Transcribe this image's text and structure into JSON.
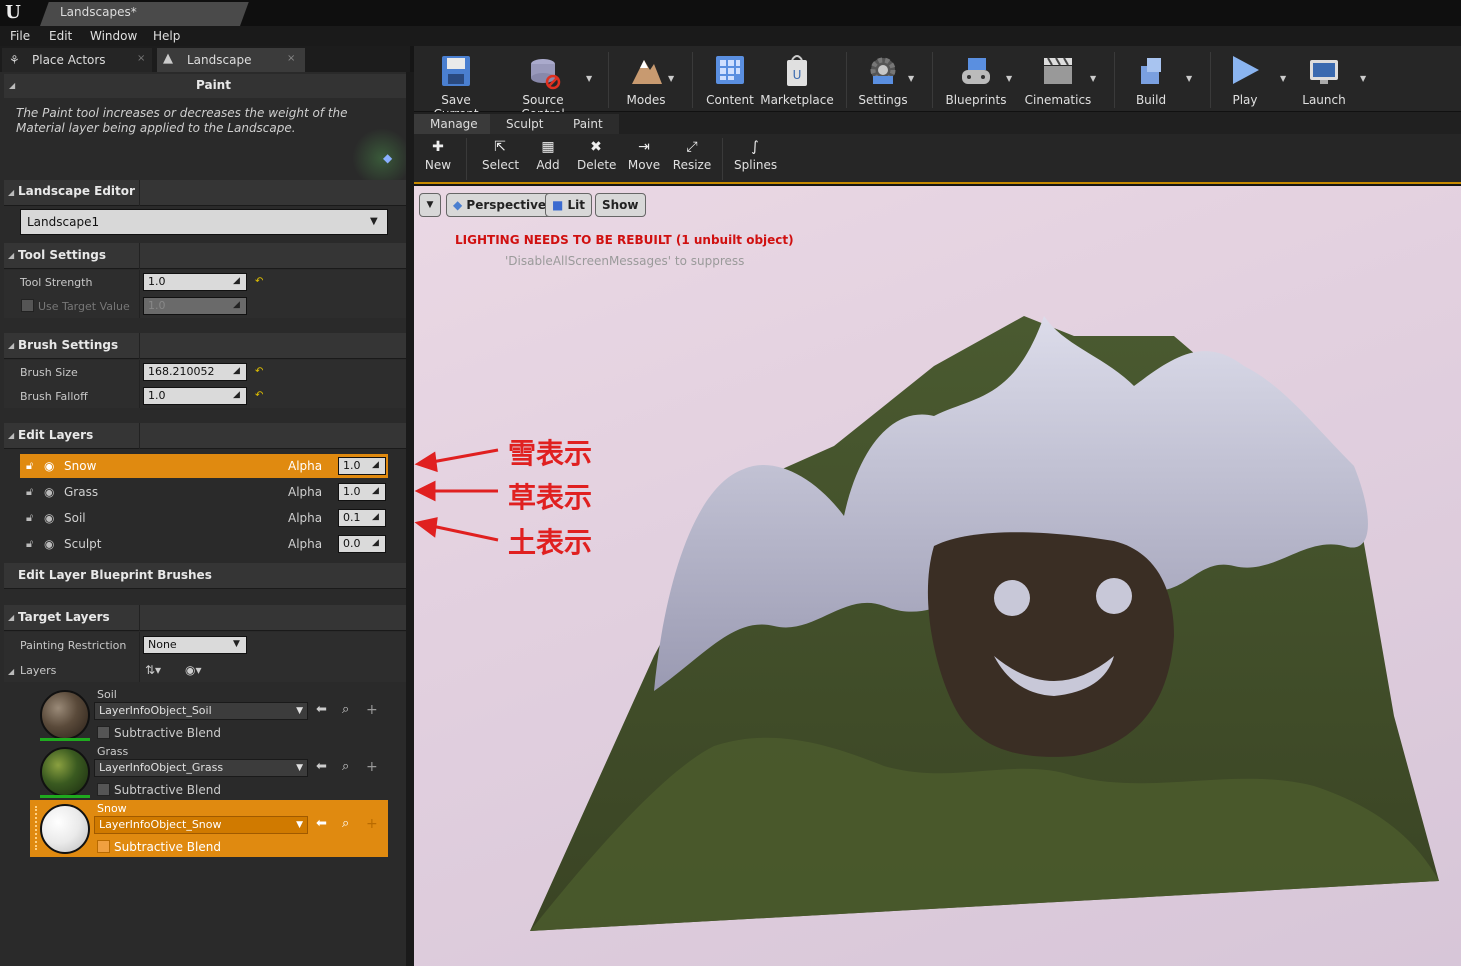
{
  "window": {
    "doc_tab": "Landscapes*"
  },
  "menu": [
    "File",
    "Edit",
    "Window",
    "Help"
  ],
  "left_tabs": {
    "place_actors": "Place Actors",
    "landscape": "Landscape"
  },
  "paint": {
    "title": "Paint",
    "description": "The Paint tool increases or decreases the weight of the Material layer being applied to the Landscape."
  },
  "landscape_editor": {
    "title": "Landscape Editor",
    "selected": "Landscape1"
  },
  "tool_settings": {
    "title": "Tool Settings",
    "tool_strength_label": "Tool Strength",
    "tool_strength": "1.0",
    "use_target_label": "Use Target Value",
    "use_target": "1.0"
  },
  "brush_settings": {
    "title": "Brush Settings",
    "size_label": "Brush Size",
    "size": "168.210052",
    "falloff_label": "Brush Falloff",
    "falloff": "1.0"
  },
  "edit_layers": {
    "title": "Edit Layers",
    "rows": [
      {
        "name": "Snow",
        "alpha_label": "Alpha",
        "alpha": "1.0"
      },
      {
        "name": "Grass",
        "alpha_label": "Alpha",
        "alpha": "1.0"
      },
      {
        "name": "Soil",
        "alpha_label": "Alpha",
        "alpha": "0.1"
      },
      {
        "name": "Sculpt",
        "alpha_label": "Alpha",
        "alpha": "0.0"
      }
    ]
  },
  "blueprint_brushes": {
    "title": "Edit Layer Blueprint Brushes"
  },
  "target_layers": {
    "title": "Target Layers",
    "restriction_label": "Painting Restriction",
    "restriction": "None",
    "layers_label": "Layers",
    "items": [
      {
        "name": "Soil",
        "object": "LayerInfoObject_Soil",
        "blend": "Subtractive Blend"
      },
      {
        "name": "Grass",
        "object": "LayerInfoObject_Grass",
        "blend": "Subtractive Blend"
      },
      {
        "name": "Snow",
        "object": "LayerInfoObject_Snow",
        "blend": "Subtractive Blend"
      }
    ]
  },
  "toolbar": {
    "save_current": "Save Current",
    "source_control": "Source Control",
    "modes": "Modes",
    "content": "Content",
    "marketplace": "Marketplace",
    "settings": "Settings",
    "blueprints": "Blueprints",
    "cinematics": "Cinematics",
    "build": "Build",
    "play": "Play",
    "launch": "Launch"
  },
  "mode_tabs": [
    "Manage",
    "Sculpt",
    "Paint"
  ],
  "mode_tools": [
    "New",
    "Select",
    "Add",
    "Delete",
    "Move",
    "Resize",
    "Splines"
  ],
  "viewport": {
    "perspective": "Perspective",
    "lit": "Lit",
    "show": "Show",
    "warning": "LIGHTING NEEDS TO BE REBUILT (1 unbuilt object)",
    "suppress": "'DisableAllScreenMessages' to suppress"
  },
  "annotations": [
    "雪表示",
    "草表示",
    "土表示"
  ],
  "colors": {
    "accent": "#e08a10",
    "annotation": "#e02020"
  }
}
